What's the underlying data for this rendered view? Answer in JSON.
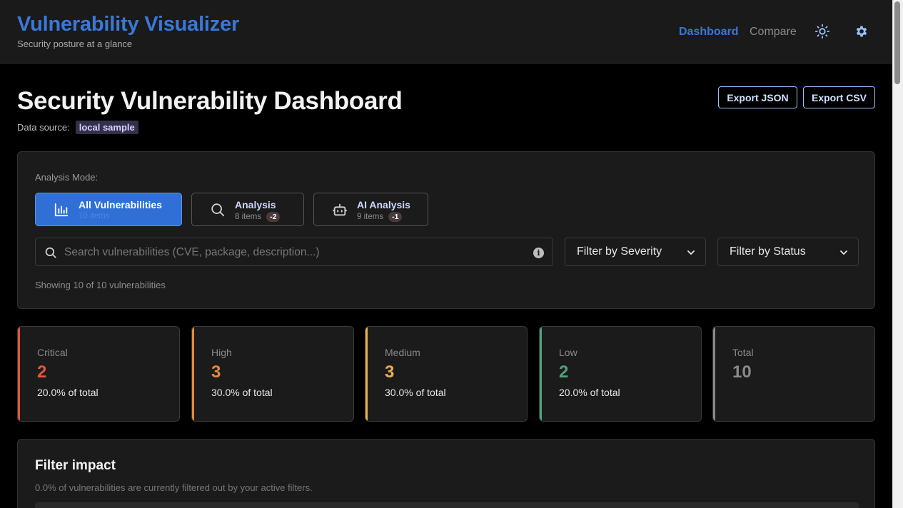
{
  "header": {
    "title": "Vulnerability Visualizer",
    "subtitle": "Security posture at a glance",
    "nav": {
      "dashboard": "Dashboard",
      "compare": "Compare"
    },
    "icons": {
      "theme": "sun-icon",
      "settings": "gear-icon"
    }
  },
  "page": {
    "title": "Security Vulnerability Dashboard",
    "datasource_label": "Data source:",
    "datasource_value": "local sample",
    "export_json": "Export JSON",
    "export_csv": "Export CSV"
  },
  "analysis": {
    "mode_label": "Analysis Mode:",
    "modes": [
      {
        "name": "All Vulnerabilities",
        "count": "10 items",
        "delta": "",
        "icon": "bar-chart-icon"
      },
      {
        "name": "Analysis",
        "count": "8 items",
        "delta": "-2",
        "icon": "search-icon"
      },
      {
        "name": "AI Analysis",
        "count": "9 items",
        "delta": "-1",
        "icon": "robot-icon"
      }
    ],
    "search_placeholder": "Search vulnerabilities (CVE, package, description...)",
    "severity_filter": "Filter by Severity",
    "status_filter": "Filter by Status",
    "showing": "Showing 10 of 10 vulnerabilities"
  },
  "stats": [
    {
      "label": "Critical",
      "value": "2",
      "pct": "20.0% of total",
      "color": "#e0573f"
    },
    {
      "label": "High",
      "value": "3",
      "pct": "30.0% of total",
      "color": "#e58a3a"
    },
    {
      "label": "Medium",
      "value": "3",
      "pct": "30.0% of total",
      "color": "#e8b24a"
    },
    {
      "label": "Low",
      "value": "2",
      "pct": "20.0% of total",
      "color": "#4fa37a"
    },
    {
      "label": "Total",
      "value": "10",
      "pct": "",
      "color": "#8a8a8a"
    }
  ],
  "impact": {
    "title": "Filter impact",
    "subtitle": "0.0% of vulnerabilities are currently filtered out by your active filters.",
    "filtered_fraction": 0.0
  },
  "colors": {
    "accent": "#3a78d8",
    "background": "#000000",
    "panel": "#1b1b1b"
  }
}
